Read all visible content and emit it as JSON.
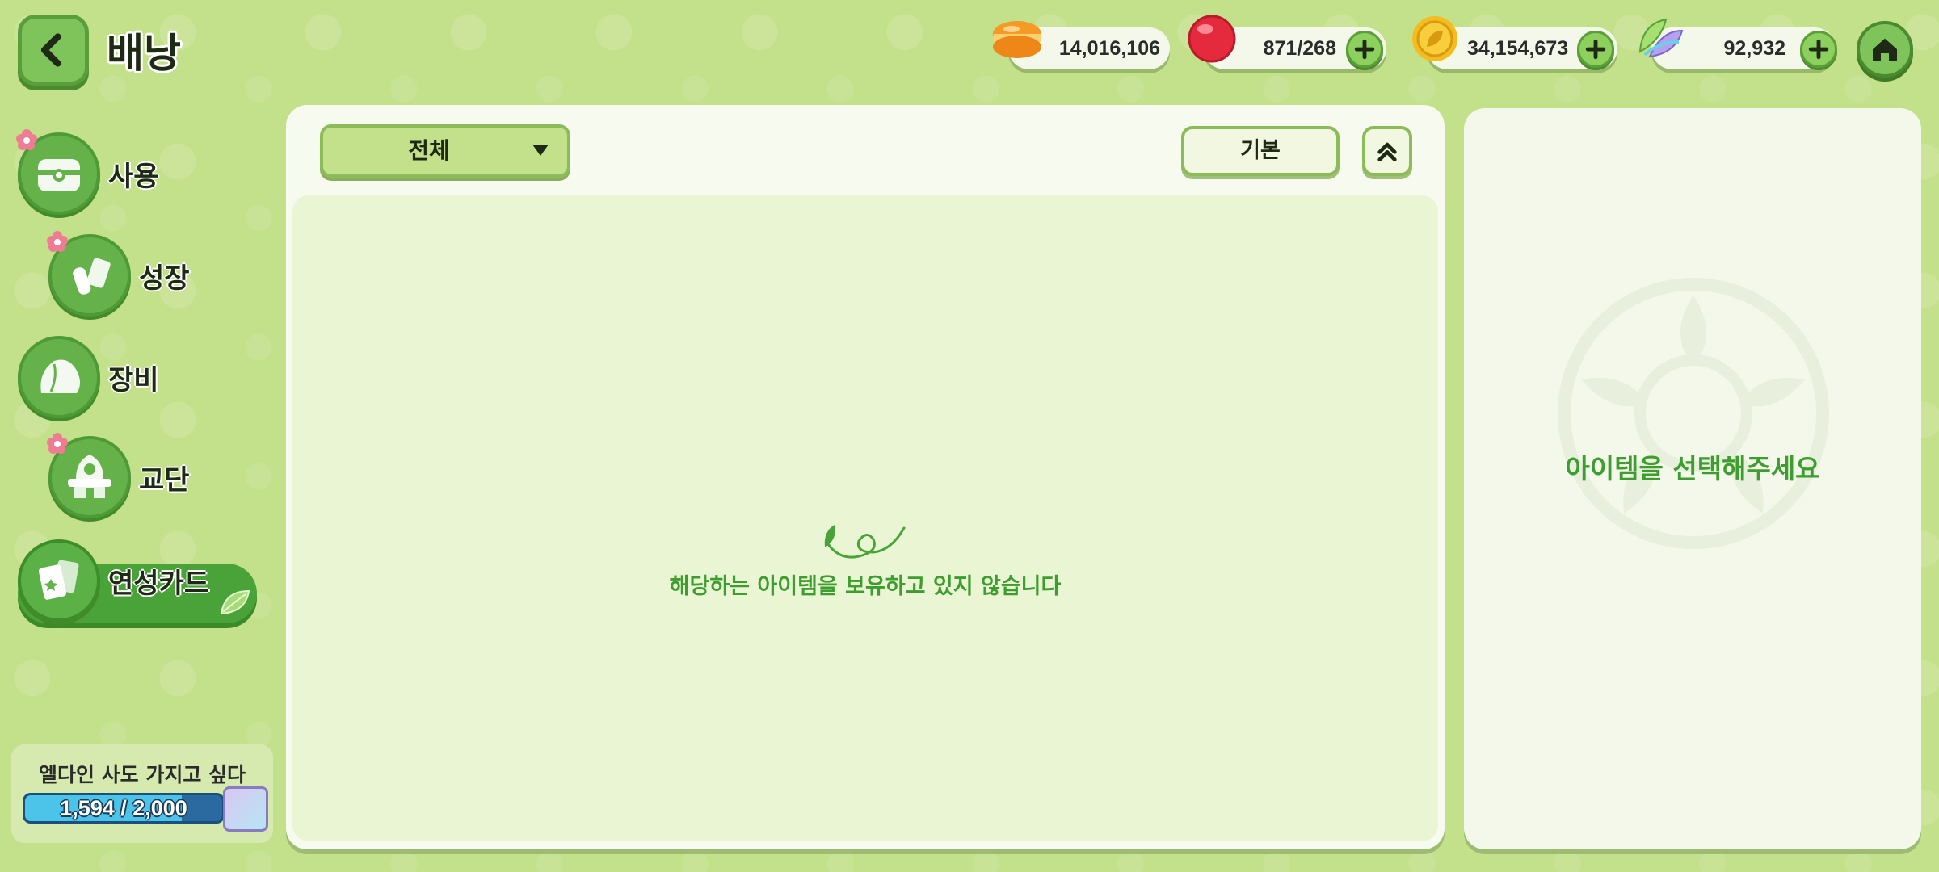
{
  "header": {
    "title": "배낭"
  },
  "currencies": [
    {
      "name": "gold-macaron",
      "value": "14,016,106",
      "has_plus": false,
      "color": "#f08a1c"
    },
    {
      "name": "red-candy",
      "value": "871/268",
      "has_plus": true,
      "color": "#e0283c"
    },
    {
      "name": "leaf-coin",
      "value": "34,154,673",
      "has_plus": true,
      "color": "#f0b418"
    },
    {
      "name": "rainbow-leaf",
      "value": "92,932",
      "has_plus": true,
      "color": "#7cd0e0"
    }
  ],
  "sidebar": {
    "items": [
      {
        "label": "사용",
        "badge": true,
        "icon": "chest-icon"
      },
      {
        "label": "성장",
        "badge": true,
        "icon": "potion-icon"
      },
      {
        "label": "장비",
        "badge": false,
        "icon": "equipment-icon"
      },
      {
        "label": "교단",
        "badge": true,
        "icon": "temple-icon"
      },
      {
        "label": "연성카드",
        "badge": false,
        "icon": "card-icon",
        "active": true
      }
    ]
  },
  "quest": {
    "title": "엘다인 사도 가지고 싶다",
    "progress_text": "1,594 / 2,000",
    "progress_fraction": 0.797
  },
  "main": {
    "filter_label": "전체",
    "sort_label": "기본",
    "empty_text": "해당하는 아이템을 보유하고 있지 않습니다"
  },
  "detail": {
    "placeholder": "아이템을 선택해주세요"
  },
  "colors": {
    "background": "#c3e08a",
    "accent_green": "#3d9d2e",
    "panel": "#f7faef"
  }
}
